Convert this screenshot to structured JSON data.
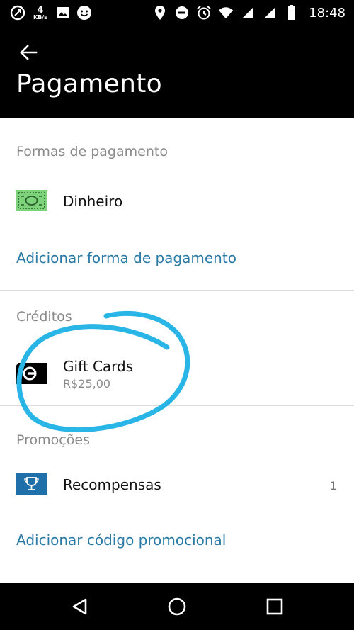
{
  "status_bar": {
    "network_speed_value": "4",
    "network_speed_unit": "KB/s",
    "time": "18:48",
    "left_icons": [
      "data-saver-icon",
      "image-icon",
      "emoji-icon"
    ],
    "right_icons": [
      "location-icon",
      "do-not-disturb-icon",
      "alarm-icon",
      "wifi-icon",
      "signal-icon",
      "signal-icon",
      "battery-icon"
    ]
  },
  "header": {
    "title": "Pagamento"
  },
  "payment_methods": {
    "section_label": "Formas de pagamento",
    "items": [
      {
        "label": "Dinheiro",
        "icon": "cash-icon"
      }
    ],
    "add_link": "Adicionar forma de pagamento"
  },
  "credits": {
    "section_label": "Créditos",
    "items": [
      {
        "label": "Gift Cards",
        "value": "R$25,00",
        "icon": "uber-gift-card-icon"
      }
    ]
  },
  "promotions": {
    "section_label": "Promoções",
    "items": [
      {
        "label": "Recompensas",
        "count": "1",
        "icon": "trophy-icon"
      }
    ],
    "add_link": "Adicionar código promocional"
  },
  "colors": {
    "link": "#2a7aa6",
    "annotation": "#29b6e6",
    "cash_green": "#7dd37a",
    "trophy_blue": "#1f6fa8"
  }
}
